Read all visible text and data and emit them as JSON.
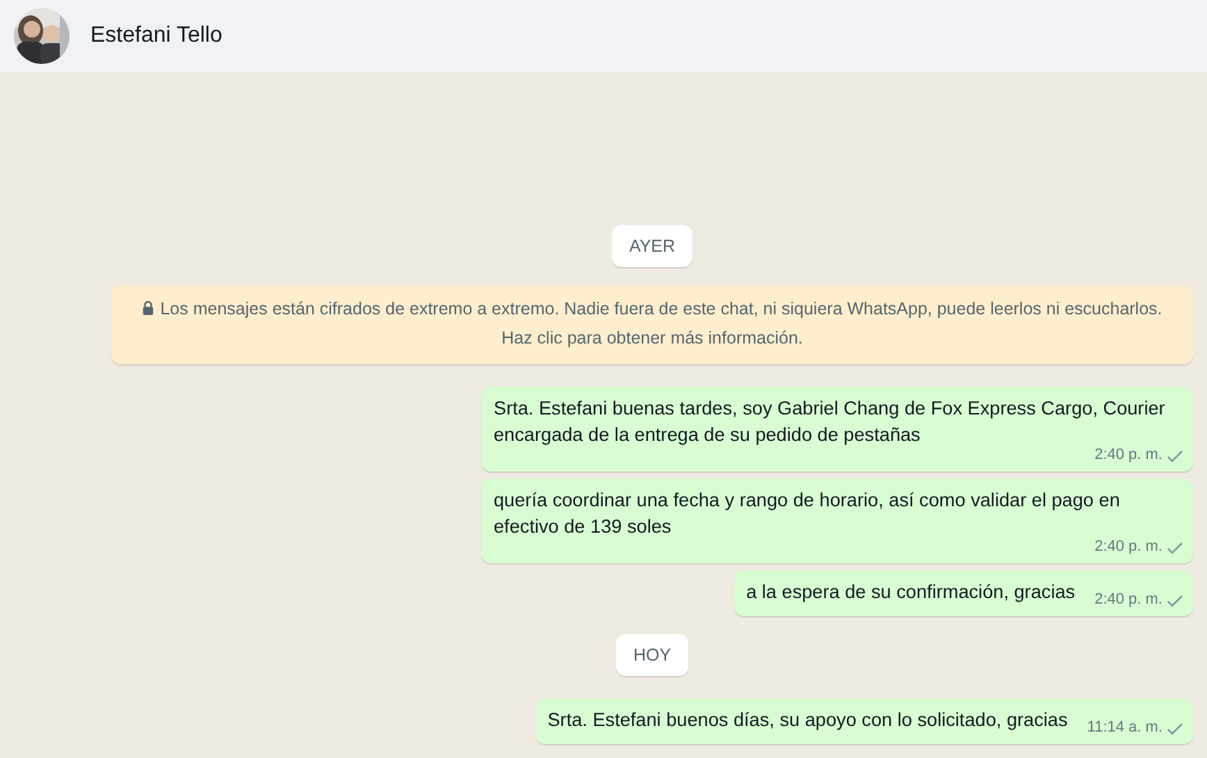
{
  "header": {
    "contact_name": "Estefani Tello"
  },
  "items": [
    {
      "kind": "date",
      "text": "AYER"
    },
    {
      "kind": "notice",
      "text": "Los mensajes están cifrados de extremo a extremo. Nadie fuera de este chat, ni siquiera WhatsApp, puede leerlos ni escucharlos. Haz clic para obtener más información."
    },
    {
      "kind": "message",
      "text": "Srta. Estefani buenas tardes, soy Gabriel Chang de Fox Express Cargo, Courier encargada de la entrega de su pedido de pestañas",
      "time": "2:40 p. m.",
      "sent": true
    },
    {
      "kind": "message",
      "text": "quería coordinar una fecha y rango de horario, así como validar el pago en efectivo de 139 soles",
      "time": "2:40 p. m.",
      "sent": true
    },
    {
      "kind": "message",
      "text": "a la espera de su confirmación, gracias",
      "time": "2:40 p. m.",
      "sent": true
    },
    {
      "kind": "date",
      "text": "HOY"
    },
    {
      "kind": "message",
      "text": "Srta. Estefani buenos días, su apoyo con lo solicitado, gracias",
      "time": "11:14 a. m.",
      "sent": true
    }
  ]
}
